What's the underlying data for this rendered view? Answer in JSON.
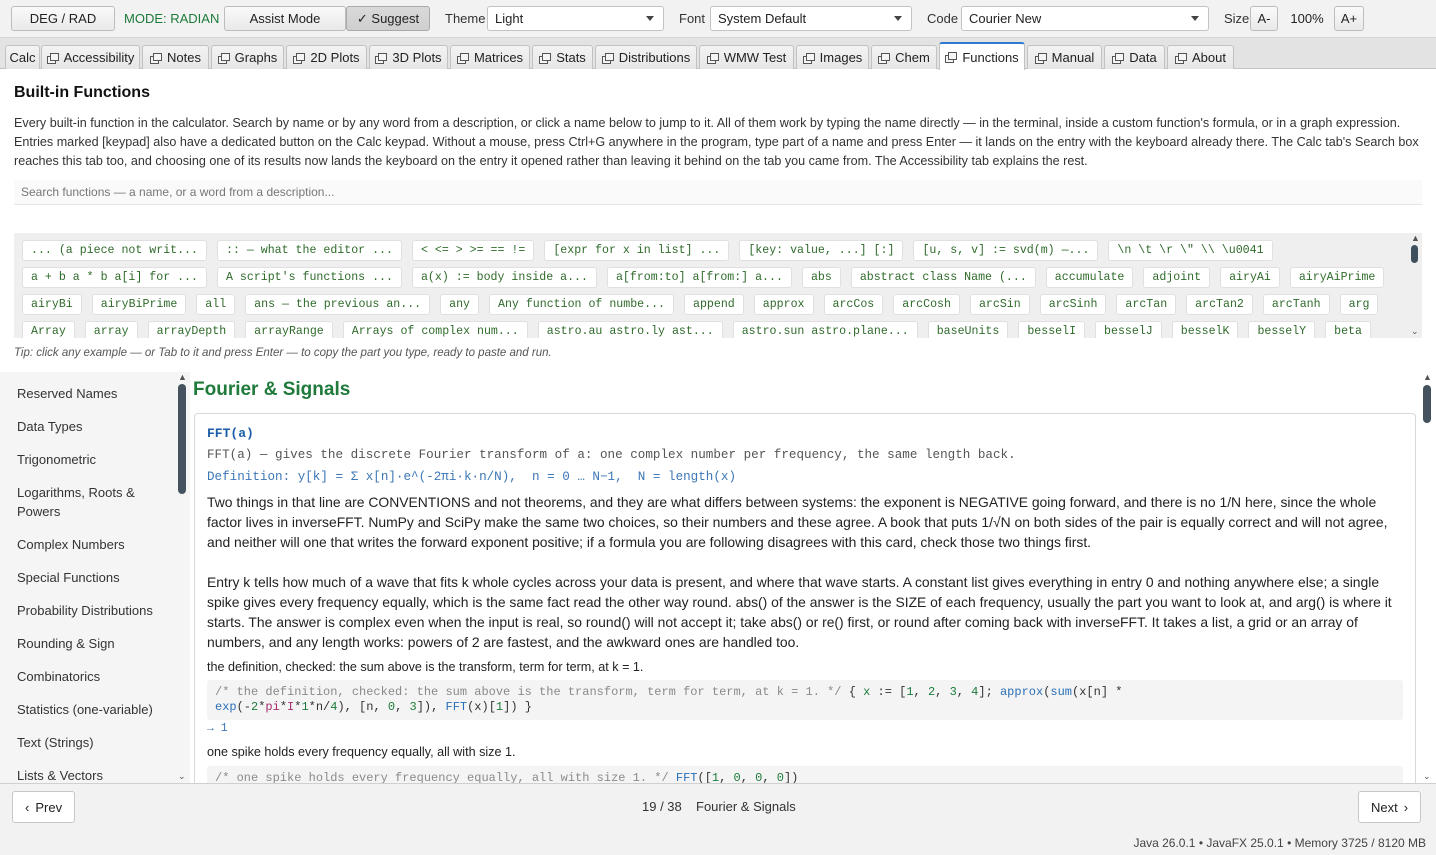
{
  "toolbar": {
    "deg_rad_label": "DEG / RAD",
    "mode_text": "MODE: RADIAN",
    "assist_label": "Assist Mode",
    "suggest_label": "✓ Suggest",
    "theme_label": "Theme",
    "theme_value": "Light",
    "font_label": "Font",
    "font_value": "System Default",
    "code_label": "Code",
    "code_value": "Courier New",
    "size_label": "Size",
    "size_dec": "A-",
    "size_value": "100%",
    "size_inc": "A+"
  },
  "tabs": [
    "Calc",
    "Accessibility",
    "Notes",
    "Graphs",
    "2D Plots",
    "3D Plots",
    "Matrices",
    "Stats",
    "Distributions",
    "WMW Test",
    "Images",
    "Chem",
    "Functions",
    "Manual",
    "Data",
    "About"
  ],
  "active_tab": "Functions",
  "page": {
    "title": "Built-in Functions",
    "intro": "Every built-in function in the calculator. Search by name or by any word from a description, or click a name below to jump to it. All of them work by typing the name directly — in the terminal, inside a custom function's formula, or in a graph expression. Entries marked [keypad] also have a dedicated button on the Calc keypad. Without a mouse, press Ctrl+G anywhere in the program, type part of a name and press Enter — it lands on the entry with the keyboard already there. The Calc tab's Search box reaches this tab too, and choosing one of its results now lands the keyboard on the entry it opened rather than leaving it behind on the tab you came from. The Accessibility tab explains the rest.",
    "search_placeholder": "Search functions — a name, or a word from a description...",
    "tip": "Tip: click any example — or Tab to it and press Enter — to copy the part you type, ready to paste and run."
  },
  "chips": [
    "... (a piece not writ...",
    ":: — what the editor ...",
    "< <= > >= == !=",
    "[expr for x in list] ...",
    "[key: value, ...] [:]",
    "[u, s, v] := svd(m) —...",
    "\\n \\t \\r \\\" \\\\ \\u0041",
    "a + b a * b a[i] for ...",
    "A script's functions ...",
    "a(x) := body inside a...",
    "a[from:to] a[from:] a...",
    "abs",
    "abstract class Name (...",
    "accumulate",
    "adjoint",
    "airyAi",
    "airyAiPrime",
    "airyBi",
    "airyBiPrime",
    "all",
    "ans — the previous an...",
    "any",
    "Any function of numbe...",
    "append",
    "approx",
    "arcCos",
    "arcCosh",
    "arcSin",
    "arcSinh",
    "arcTan",
    "arcTan2",
    "arcTanh",
    "arg",
    "Array",
    "array",
    "arrayDepth",
    "arrayRange",
    "Arrays of complex num...",
    "astro.au astro.ly ast...",
    "astro.sun astro.plane...",
    "baseUnits",
    "besselI",
    "besselJ",
    "besselK",
    "besselY",
    "beta"
  ],
  "sidebar": {
    "items": [
      "Reserved Names",
      "Data Types",
      "Trigonometric",
      "Logarithms, Roots & Powers",
      "Complex Numbers",
      "Special Functions",
      "Probability Distributions",
      "Rounding & Sign",
      "Combinatorics",
      "Statistics (one-variable)",
      "Text (Strings)",
      "Lists & Vectors"
    ]
  },
  "section": {
    "title": "Fourier & Signals",
    "fn_name": "FFT(a)",
    "fn_signature": "FFT(a) — gives the discrete Fourier transform of a: one complex number per frequency, the same length back.",
    "fn_definition": "Definition: y[k] = Σ x[n]·e^(-2πi·k·n/N),  n = 0 … N−1,  N = length(x)",
    "para1": "Two things in that line are CONVENTIONS and not theorems, and they are what differs between systems: the exponent is NEGATIVE going forward, and there is no 1/N here, since the whole factor lives in inverseFFT. NumPy and SciPy make the same two choices, so their numbers and these agree. A book that puts 1/√N on both sides of the pair is equally correct and will not agree, and neither will one that writes the forward exponent positive; if a formula you are following disagrees with this card, check those two things first.",
    "para2": "Entry k tells how much of a wave that fits k whole cycles across your data is present, and where that wave starts. A constant list gives everything in entry 0 and nothing anywhere else; a single spike gives every frequency equally, which is the same fact read the other way round. abs() of the answer is the SIZE of each frequency, usually the part you want to look at, and arg() is where it starts. The answer is complex even when the input is real, so round() will not accept it; take abs() or re() first, or round after coming back with inverseFFT. It takes a list, a grid or an array of numbers, and any length works: powers of 2 are fastest, and the awkward ones are handled too.",
    "example1_label": "the definition, checked: the sum above is the transform, term for term, at k = 1.",
    "example1_comment": "/* the definition, checked: the sum above is the transform, term for term, at k = 1. */",
    "example1_result": "→ 1",
    "example2_label": "one spike holds every frequency equally, all with size 1.",
    "example2_comment": "/* one spike holds every frequency equally, all with size 1. */"
  },
  "footer": {
    "prev_label": "Prev",
    "next_label": "Next",
    "page_indicator": "19 / 38",
    "page_section": "Fourier & Signals",
    "status": "Java 26.0.1  •  JavaFX 25.0.1  •  Memory 3725 / 8120 MB"
  },
  "colors": {
    "accent_green": "#1f7a3c",
    "link_blue": "#1a5ea8",
    "active_tab_blue": "#2f7ad1"
  }
}
